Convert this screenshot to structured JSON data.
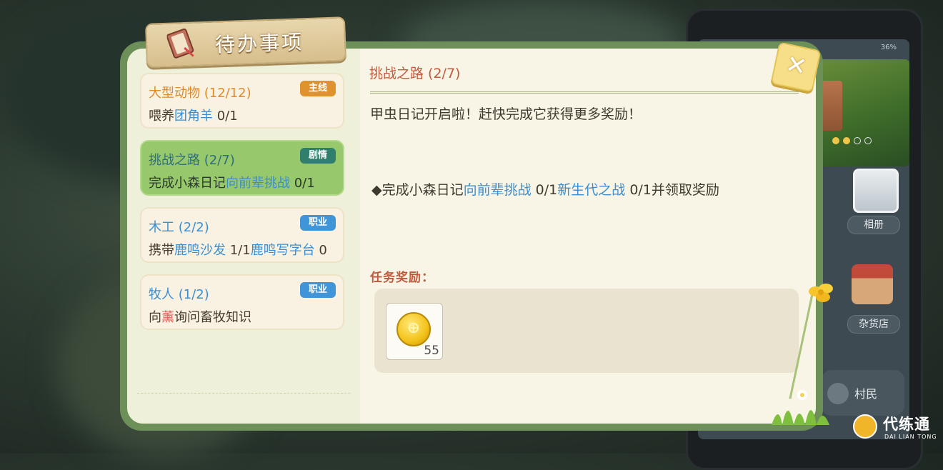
{
  "panel": {
    "title": "待办事项"
  },
  "quests": [
    {
      "name": "大型动物 (12/12)",
      "tag": "主线",
      "tag_color": "#e0922e",
      "name_color": "#e08a2a",
      "desc_parts": [
        {
          "t": "喂养",
          "c": ""
        },
        {
          "t": "团角羊",
          "c": "hl"
        },
        {
          "t": " 0/1",
          "c": ""
        }
      ]
    },
    {
      "name": "挑战之路 (2/7)",
      "tag": "剧情",
      "tag_color": "#2f7f6c",
      "name_color": "#2f6e7a",
      "active": true,
      "desc_parts": [
        {
          "t": "完成小森日记",
          "c": ""
        },
        {
          "t": "向前辈挑战",
          "c": "hl"
        },
        {
          "t": " 0/1",
          "c": ""
        }
      ]
    },
    {
      "name": "木工 (2/2)",
      "tag": "职业",
      "tag_color": "#3f95d8",
      "name_color": "#3b8ed0",
      "desc_parts": [
        {
          "t": "携带",
          "c": ""
        },
        {
          "t": "鹿鸣沙发",
          "c": "hl"
        },
        {
          "t": " 1/1",
          "c": ""
        },
        {
          "t": "鹿鸣写字台",
          "c": "hl"
        },
        {
          "t": " 0",
          "c": ""
        }
      ]
    },
    {
      "name": "牧人 (1/2)",
      "tag": "职业",
      "tag_color": "#3f95d8",
      "name_color": "#3b8ed0",
      "desc_parts": [
        {
          "t": "向",
          "c": ""
        },
        {
          "t": "薰",
          "c": "hl-red"
        },
        {
          "t": "询问畜牧知识",
          "c": ""
        }
      ]
    }
  ],
  "detail": {
    "title": "挑战之路 (2/7)",
    "intro": "甲虫日记开启啦！赶快完成它获得更多奖励！",
    "goal_parts": [
      {
        "t": "◆完成小森日记",
        "c": ""
      },
      {
        "t": "向前辈挑战",
        "c": "hl"
      },
      {
        "t": " 0/1",
        "c": ""
      },
      {
        "t": "新生代之战",
        "c": "hl"
      },
      {
        "t": " 0/1并领取奖励",
        "c": ""
      }
    ],
    "reward_label": "任务奖励：",
    "reward_count": "55"
  },
  "phone": {
    "battery": "36%",
    "album_label": "相册",
    "store_label": "杂货店",
    "villager_label": "村民"
  },
  "watermark": {
    "name": "代练通",
    "sub": "DAI LIAN TONG"
  },
  "colors": {
    "panel_frame": "#6d8f58",
    "accent_red": "#c25a3e",
    "highlight_blue": "#3b8ed0"
  },
  "icons": [
    "book-icon",
    "close-icon",
    "gold-coin-icon",
    "flower-icon",
    "grass-icon"
  ]
}
